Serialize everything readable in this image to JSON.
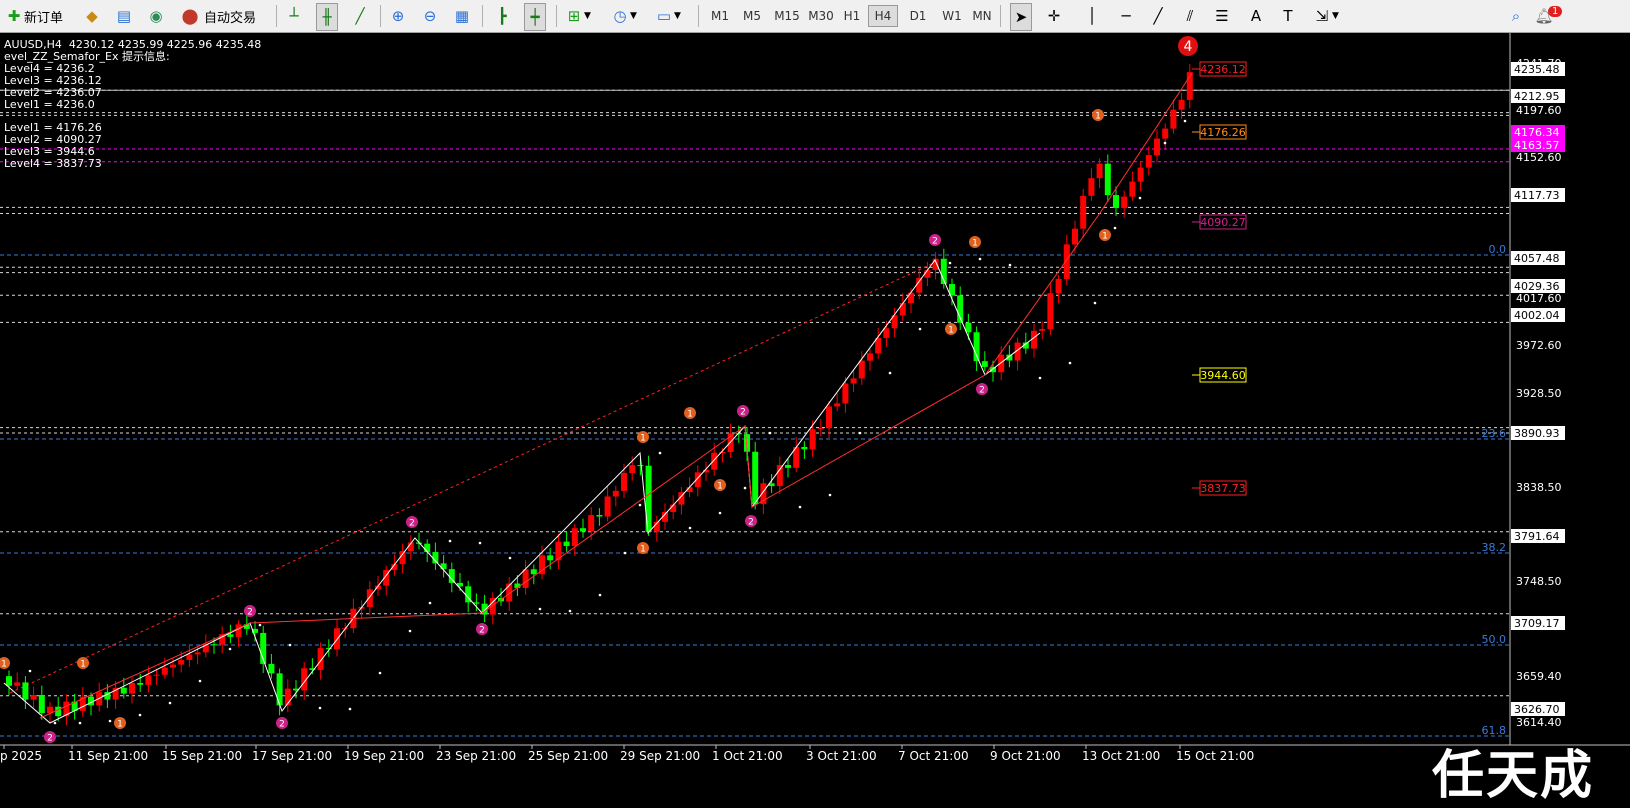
{
  "toolbar": {
    "new_order_label": "新订单",
    "auto_trade_label": "自动交易",
    "timeframes": [
      "M1",
      "M5",
      "M15",
      "M30",
      "H1",
      "H4",
      "D1",
      "W1",
      "MN"
    ],
    "active_timeframe": "H4",
    "alert_badge": "1"
  },
  "info_panel": {
    "symbol_line": "AUUSD,H4  4230.12 4235.99 4225.96 4235.48",
    "indicator_line": "evel_ZZ_Semafor_Ex 提示信息:",
    "upper_levels": [
      "Level4 = 4236.2",
      "Level3 = 4236.12",
      "Level2 = 4236.07",
      "Level1 = 4236.0"
    ],
    "lower_levels": [
      "Level1 = 4176.26",
      "Level2 = 4090.27",
      "Level3 = 3944.6",
      "Level4 = 3837.73"
    ]
  },
  "watermark": "任天成",
  "chart_data": {
    "type": "candlestick",
    "symbol": "AUUSD",
    "timeframe": "H4",
    "ohlc_last": {
      "open": 4230.12,
      "high": 4235.99,
      "low": 4225.96,
      "close": 4235.48
    },
    "x_tick_labels": [
      "p 2025",
      "11 Sep 21:00",
      "15 Sep 21:00",
      "17 Sep 21:00",
      "19 Sep 21:00",
      "23 Sep 21:00",
      "25 Sep 21:00",
      "29 Sep 21:00",
      "1 Oct 21:00",
      "3 Oct 21:00",
      "7 Oct 21:00",
      "9 Oct 21:00",
      "13 Oct 21:00",
      "15 Oct 21:00"
    ],
    "y_tick_labels": [
      "4241.70",
      "4197.60",
      "4152.60",
      "4017.60",
      "3972.60",
      "3928.50",
      "3838.50",
      "3748.50",
      "3659.40",
      "3614.40"
    ],
    "price_tags": [
      {
        "value": "4235.48",
        "bg": "#ffffff",
        "fg": "#000000"
      },
      {
        "value": "4212.95",
        "bg": "#ffffff",
        "fg": "#000000"
      },
      {
        "value": "4176.34",
        "bg": "#ff00ff",
        "fg": "#ffffff"
      },
      {
        "value": "4163.57",
        "bg": "#ff00ff",
        "fg": "#ffffff"
      },
      {
        "value": "4117.73",
        "bg": "#ffffff",
        "fg": "#000000"
      },
      {
        "value": "4057.48",
        "bg": "#ffffff",
        "fg": "#000000"
      },
      {
        "value": "4029.36",
        "bg": "#ffffff",
        "fg": "#000000"
      },
      {
        "value": "4002.04",
        "bg": "#ffffff",
        "fg": "#000000"
      },
      {
        "value": "3890.93",
        "bg": "#ffffff",
        "fg": "#000000"
      },
      {
        "value": "3791.64",
        "bg": "#ffffff",
        "fg": "#000000"
      },
      {
        "value": "3709.17",
        "bg": "#ffffff",
        "fg": "#000000"
      },
      {
        "value": "3626.70",
        "bg": "#ffffff",
        "fg": "#000000"
      }
    ],
    "fib_labels": [
      "0.0",
      "23.6",
      "38.2",
      "50.0",
      "61.8"
    ],
    "level_boxes": [
      {
        "value": "4236.12",
        "color": "#ff2020"
      },
      {
        "value": "4176.26",
        "color": "#ff8c1a"
      },
      {
        "value": "4090.27",
        "color": "#cc2288"
      },
      {
        "value": "3944.60",
        "color": "#ffff00"
      },
      {
        "value": "3837.73",
        "color": "#ff2020"
      }
    ],
    "semafor_big_label": "4",
    "colors": {
      "bull": "#ff0000",
      "bear": "#00ff00",
      "zigzag": "#ffffff",
      "trend": "#ff2020",
      "fib": "#3a7bd5"
    }
  }
}
